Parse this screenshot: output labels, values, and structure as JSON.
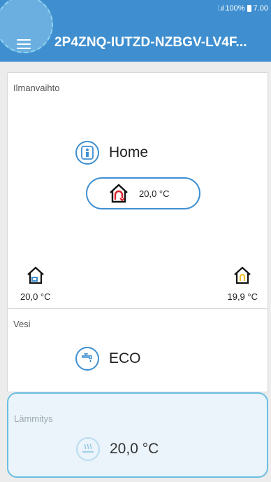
{
  "status_bar": {
    "battery": "100%",
    "time": "7.00"
  },
  "header": {
    "title": "2P4ZNQ-IUTZD-NZBGV-LV4F..."
  },
  "ventilation": {
    "label": "Ilmanvaihto",
    "mode": "Home",
    "supply_temp": "20,0 °C",
    "outdoor_temp": "20,0 °C",
    "exhaust_temp": "19,9 °C"
  },
  "water": {
    "label": "Vesi",
    "mode": "ECO"
  },
  "heating": {
    "label": "Lämmitys",
    "temperature": "20,0 °C"
  },
  "colors": {
    "primary": "#3f8fd0",
    "highlight": "#69bfe3",
    "accent_red": "#d9202a",
    "accent_yellow": "#f2c230"
  },
  "icons": [
    "menu-icon",
    "home-mode-icon",
    "house-temp-icon",
    "outdoor-air-icon",
    "exhaust-air-icon",
    "faucet-icon",
    "floor-heat-icon"
  ]
}
